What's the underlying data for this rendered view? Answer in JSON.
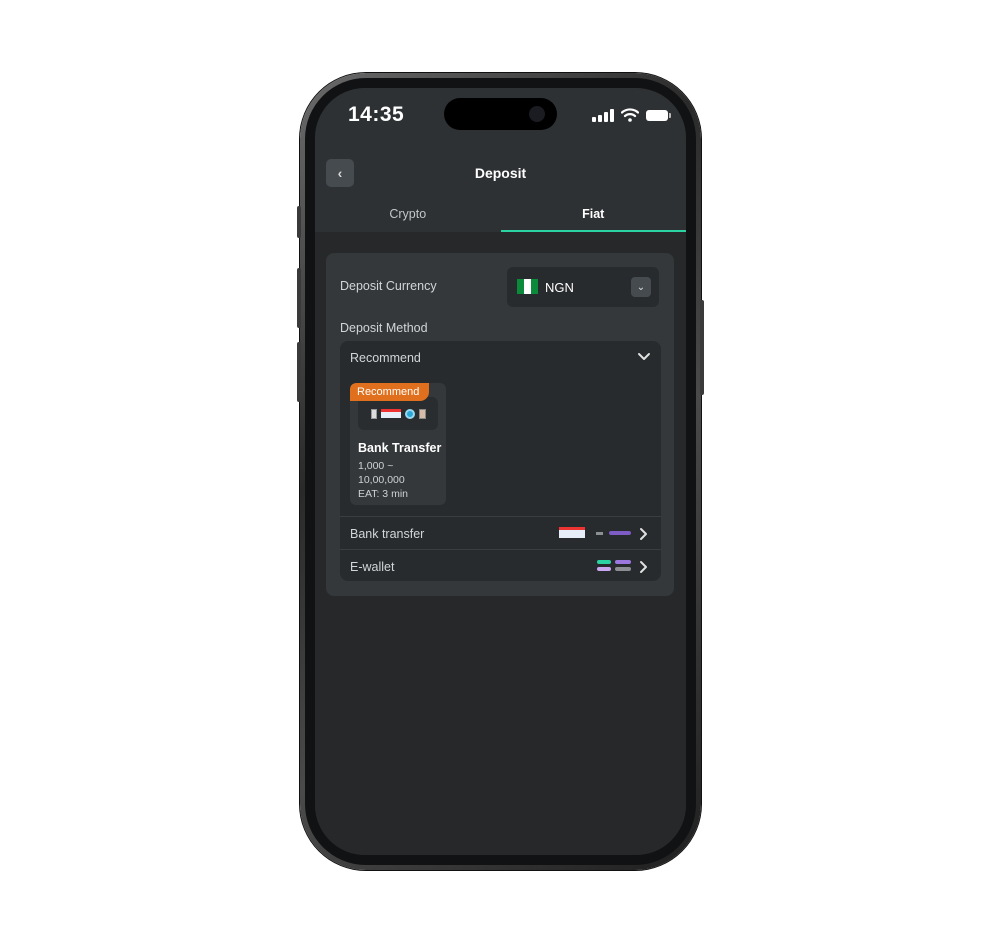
{
  "status_bar": {
    "time": "14:35"
  },
  "header": {
    "title": "Deposit",
    "back_icon": "chevron-left-icon"
  },
  "tabs": [
    {
      "label": "Crypto",
      "active": false
    },
    {
      "label": "Fiat",
      "active": true
    }
  ],
  "deposit_currency": {
    "label": "Deposit Currency",
    "value": "NGN",
    "flag": {
      "colors": [
        "#0b8a3c",
        "#ffffff",
        "#0b8a3c"
      ]
    }
  },
  "deposit_method": {
    "label": "Deposit Method",
    "recommend_section": {
      "title": "Recommend",
      "item": {
        "badge": "Recommend",
        "name": "Bank Transfer",
        "range": "1,000 ~ 10,00,000",
        "eat": "EAT: 3 min"
      }
    },
    "rows": [
      {
        "label": "Bank transfer"
      },
      {
        "label": "E-wallet"
      }
    ]
  },
  "colors": {
    "accent": "#2bd3a2",
    "badge": "#e0701d",
    "screen_bg": "#25272a",
    "card_bg": "#34383b"
  }
}
